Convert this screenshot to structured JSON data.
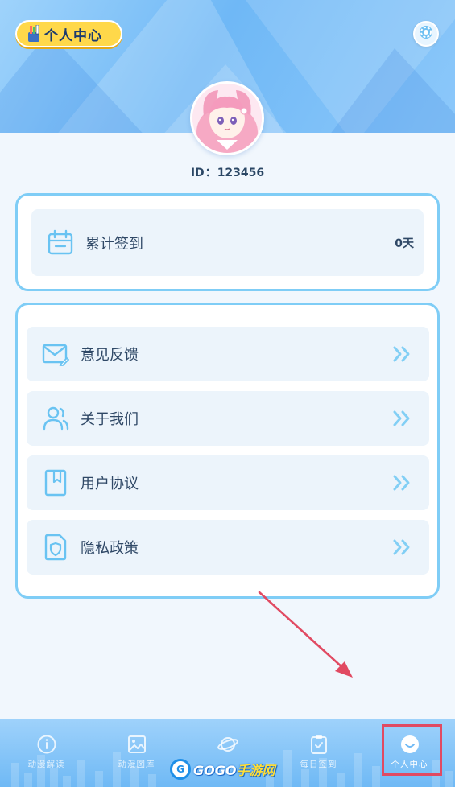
{
  "header": {
    "title": "个人中心",
    "settings_icon": "gear-icon"
  },
  "profile": {
    "id_label": "ID",
    "id_separator": "：",
    "id_value": "123456"
  },
  "checkin": {
    "label": "累计签到",
    "value": "0天",
    "icon": "calendar-icon"
  },
  "menu": {
    "items": [
      {
        "label": "意见反馈",
        "icon": "mail-edit-icon"
      },
      {
        "label": "关于我们",
        "icon": "users-icon"
      },
      {
        "label": "用户协议",
        "icon": "bookmark-icon"
      },
      {
        "label": "隐私政策",
        "icon": "shield-doc-icon"
      }
    ]
  },
  "bottom_nav": {
    "items": [
      {
        "label": "动漫解读",
        "icon": "info-icon"
      },
      {
        "label": "动漫图库",
        "icon": "image-icon"
      },
      {
        "label": "",
        "icon": "planet-icon"
      },
      {
        "label": "每日签到",
        "icon": "clipboard-check-icon"
      },
      {
        "label": "个人中心",
        "icon": "smile-icon",
        "active": true
      }
    ]
  },
  "watermark": {
    "logo_letter": "G",
    "text_a": "GOGO",
    "text_b": "手游网"
  },
  "colors": {
    "accent": "#7fcdf6",
    "badge": "#ffd84a",
    "highlight_box": "#e14a62"
  }
}
